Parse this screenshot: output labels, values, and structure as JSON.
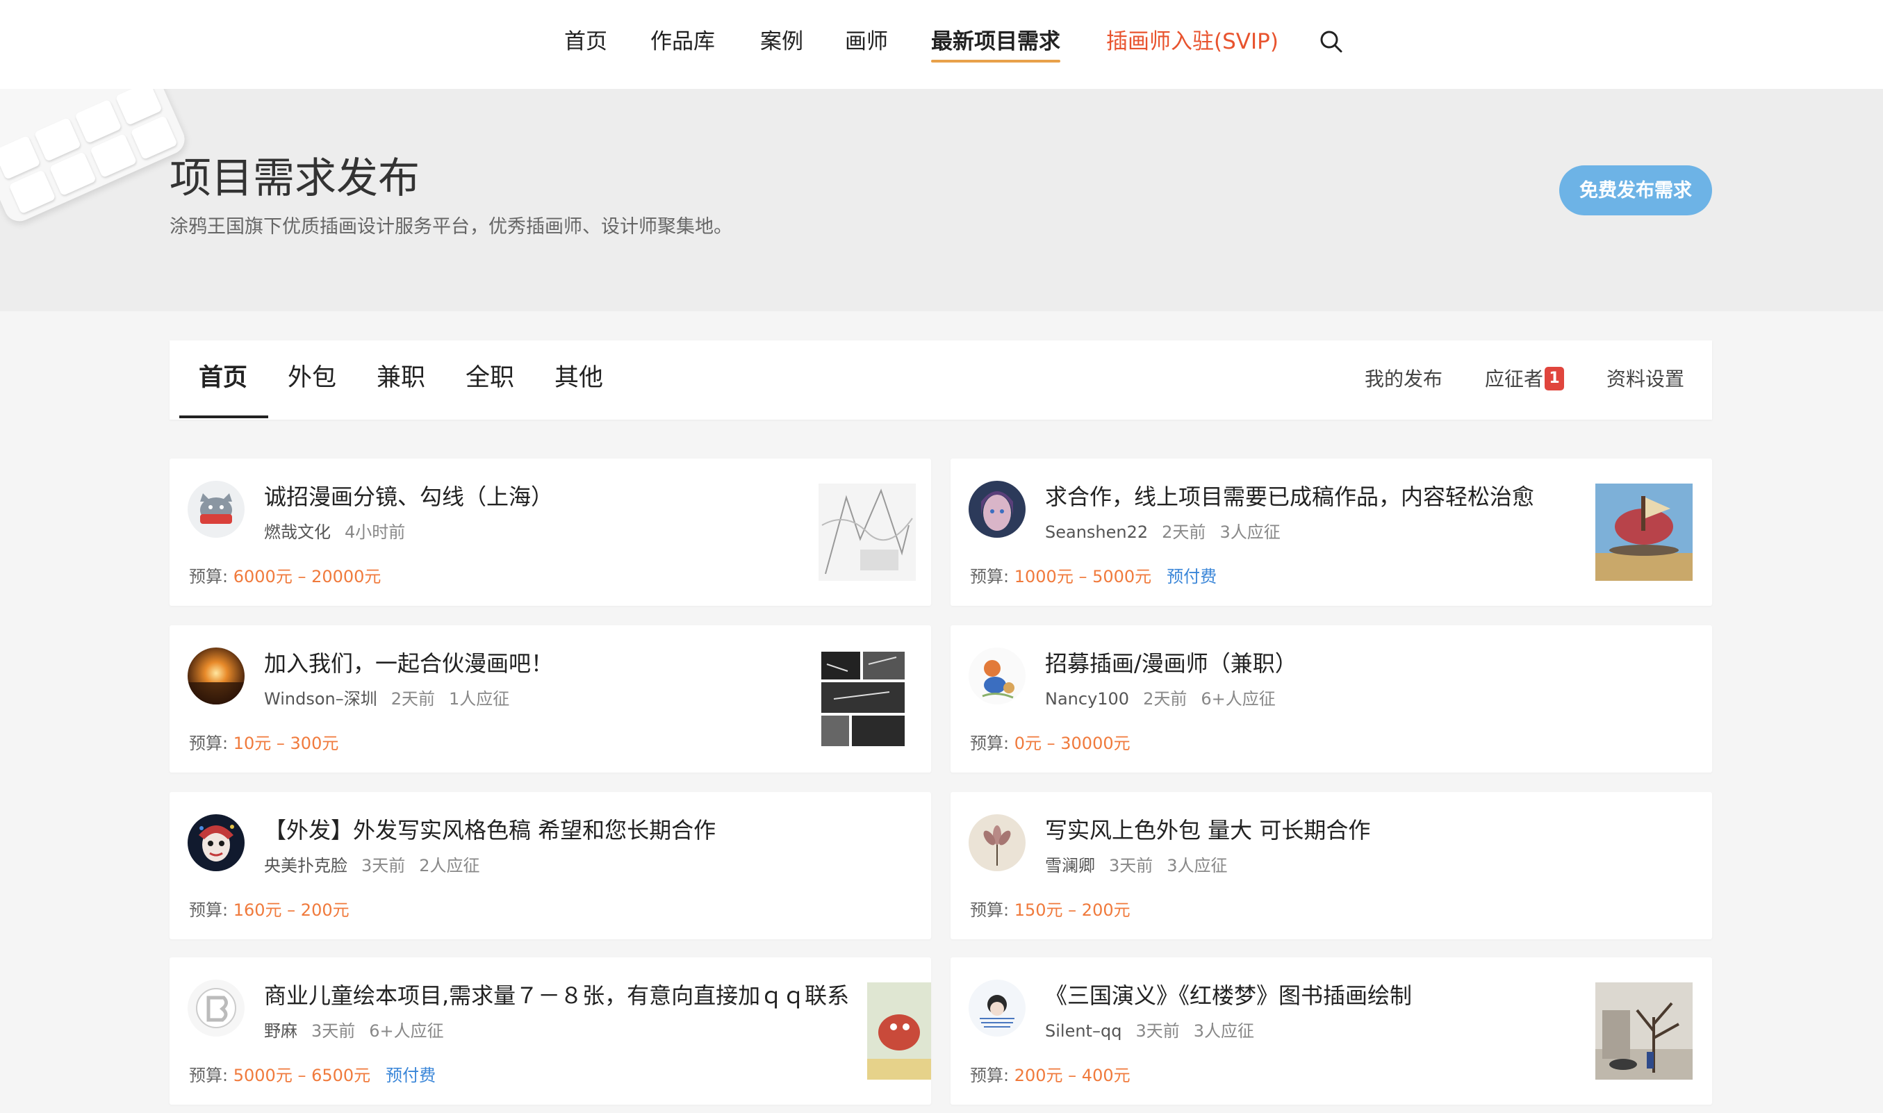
{
  "nav": {
    "items": [
      {
        "label": "首页"
      },
      {
        "label": "作品库"
      },
      {
        "label": "案例"
      },
      {
        "label": "画师"
      },
      {
        "label": "最新项目需求"
      },
      {
        "label": "插画师入驻(SVIP)"
      }
    ],
    "active_index": 4,
    "search_icon": "search-icon"
  },
  "hero": {
    "title": "项目需求发布",
    "subtitle": "涂鸦王国旗下优质插画设计服务平台，优秀插画师、设计师聚集地。",
    "publish_button": "免费发布需求",
    "accent_color": "#6db3e6"
  },
  "tabs": {
    "items": [
      "首页",
      "外包",
      "兼职",
      "全职",
      "其他"
    ],
    "active_index": 0
  },
  "user_links": {
    "my_posts": "我的发布",
    "applicants": "应征者",
    "applicants_badge": "1",
    "settings": "资料设置"
  },
  "budget_label": "预算:",
  "cards": [
    {
      "title": "诚招漫画分镜、勾线（上海）",
      "author": "燃哉文化",
      "time": "4小时前",
      "applicants": "",
      "budget": "6000元 – 20000元",
      "prepaid": ""
    },
    {
      "title": "求合作，线上项目需要已成稿作品，内容轻松治愈",
      "author": "Seanshen22",
      "time": "2天前",
      "applicants": "3人应征",
      "budget": "1000元 – 5000元",
      "prepaid": "预付费"
    },
    {
      "title": "加入我们，一起合伙漫画吧！",
      "author": "Windson–深圳",
      "time": "2天前",
      "applicants": "1人应征",
      "budget": "10元 – 300元",
      "prepaid": ""
    },
    {
      "title": "招募插画/漫画师（兼职）",
      "author": "Nancy100",
      "time": "2天前",
      "applicants": "6+人应征",
      "budget": "0元 – 30000元",
      "prepaid": ""
    },
    {
      "title": "【外发】外发写实风格色稿 希望和您长期合作",
      "author": "央美扑克脸",
      "time": "3天前",
      "applicants": "2人应征",
      "budget": "160元 – 200元",
      "prepaid": ""
    },
    {
      "title": "写实风上色外包 量大 可长期合作",
      "author": "雪澜卿",
      "time": "3天前",
      "applicants": "3人应征",
      "budget": "150元 – 200元",
      "prepaid": ""
    },
    {
      "title": "商业儿童绘本项目,需求量７－８张，有意向直接加ｑｑ联系",
      "author": "野麻",
      "time": "3天前",
      "applicants": "6+人应征",
      "budget": "5000元 – 6500元",
      "prepaid": "预付费"
    },
    {
      "title": "《三国演义》《红楼梦》图书插画绘制",
      "author": "Silent–qq",
      "time": "3天前",
      "applicants": "3人应征",
      "budget": "200元 – 400元",
      "prepaid": ""
    }
  ]
}
